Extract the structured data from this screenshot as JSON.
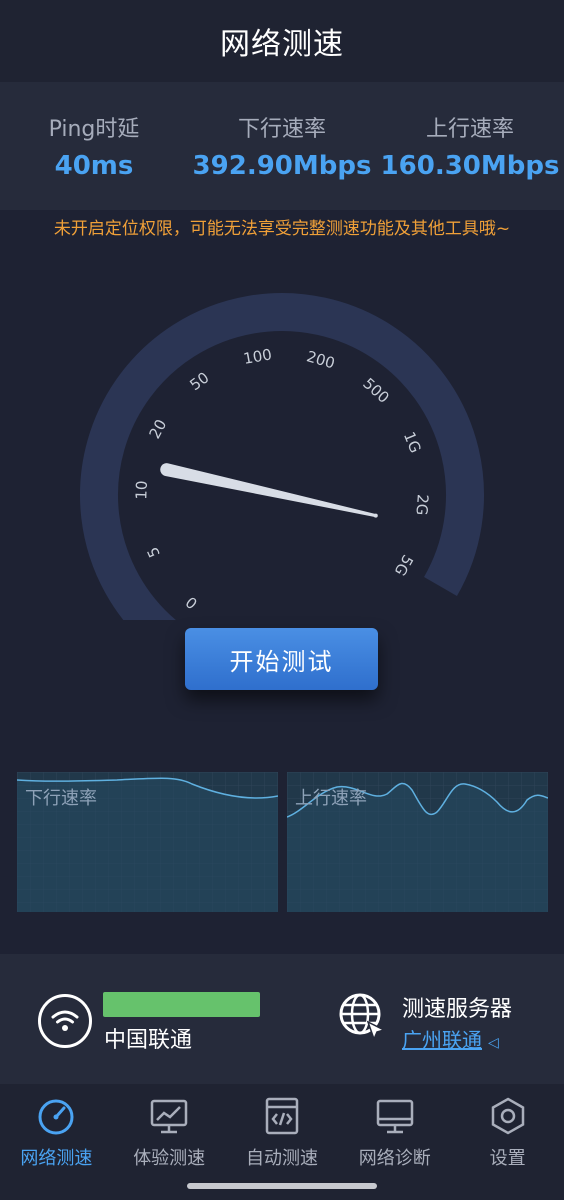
{
  "header": {
    "title": "网络测速"
  },
  "stats": [
    {
      "label": "Ping时延",
      "value": "40ms"
    },
    {
      "label": "下行速率",
      "value": "392.90Mbps"
    },
    {
      "label": "上行速率",
      "value": "160.30Mbps"
    }
  ],
  "warning": "未开启定位权限，可能无法享受完整测速功能及其他工具哦~",
  "gauge": {
    "ticks": [
      "0",
      "5",
      "10",
      "20",
      "50",
      "100",
      "200",
      "500",
      "1G",
      "2G",
      "5G"
    ],
    "needle_fraction": 0.24
  },
  "start_button": "开始测试",
  "charts": {
    "down": {
      "label": "下行速率"
    },
    "up": {
      "label": "上行速率"
    }
  },
  "network": {
    "carrier": "中国联通",
    "server_title": "测速服务器",
    "server_name": "广州联通"
  },
  "tabs": [
    {
      "label": "网络测速",
      "icon": "speedometer-icon",
      "active": true
    },
    {
      "label": "体验测速",
      "icon": "monitor-chart-icon",
      "active": false
    },
    {
      "label": "自动测速",
      "icon": "code-window-icon",
      "active": false
    },
    {
      "label": "网络诊断",
      "icon": "computer-icon",
      "active": false
    },
    {
      "label": "设置",
      "icon": "settings-hexagon-icon",
      "active": false
    }
  ],
  "colors": {
    "accent": "#4aa3f2",
    "warning": "#f0a038",
    "signal": "#66c26c",
    "gauge_track": "#2b3554"
  }
}
